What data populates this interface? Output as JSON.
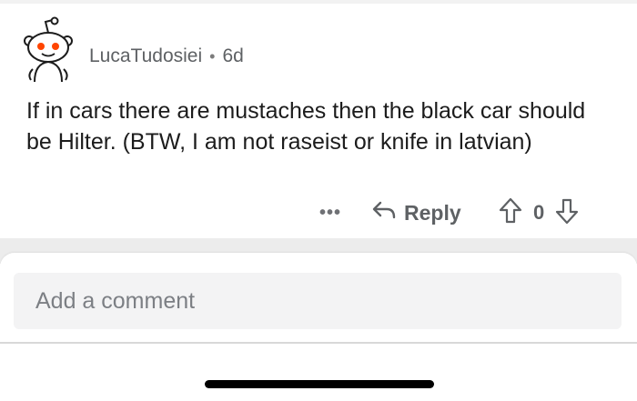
{
  "comment": {
    "username": "LucaTudosiei",
    "separator": "•",
    "age": "6d",
    "text": "If in cars there are mustaches then the black car should be Hilter. (BTW, I am not raseist or knife in latvian)",
    "avatar_icon": "reddit-snoo-avatar-icon",
    "actions": {
      "more_label": "•••",
      "reply_label": "Reply",
      "reply_icon": "reply-arrow-icon",
      "vote_count": "0",
      "upvote_icon": "upvote-arrow-icon",
      "downvote_icon": "downvote-arrow-icon"
    }
  },
  "composer": {
    "placeholder": "Add a comment",
    "value": ""
  },
  "colors": {
    "text": "#1c1c1c",
    "meta": "#5e6164",
    "input_bg": "#f3f3f4",
    "divider": "#ececec",
    "avatar_red": "#ff4500"
  }
}
